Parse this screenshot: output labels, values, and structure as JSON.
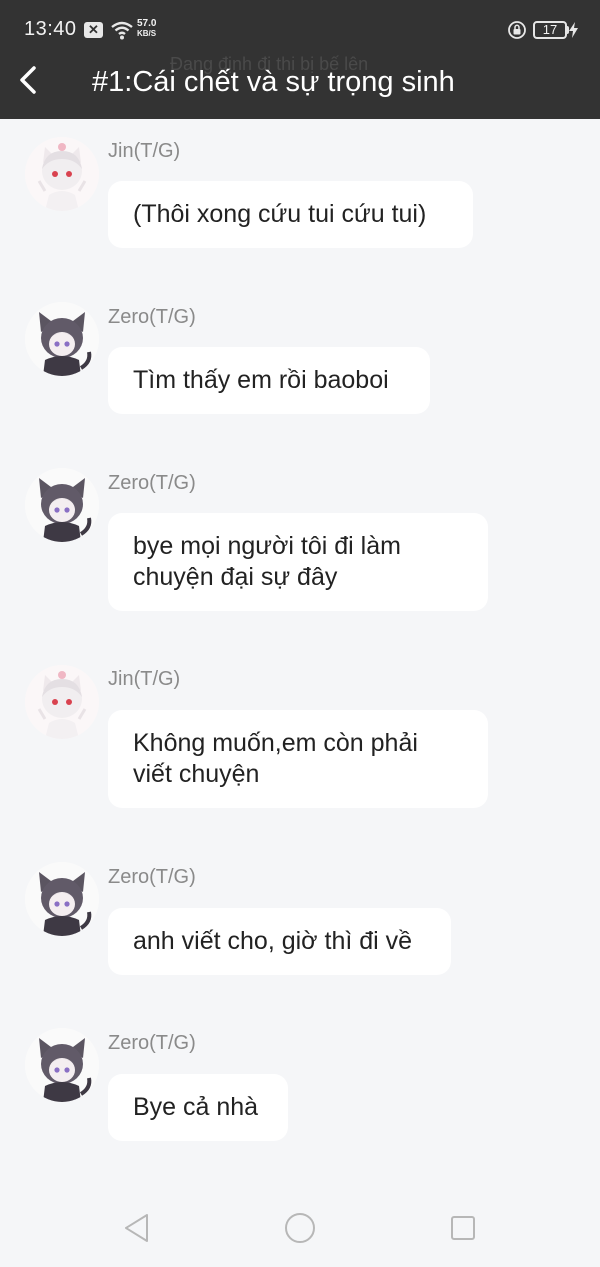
{
  "status_bar": {
    "time": "13:40",
    "speed_value": "57.0",
    "speed_unit": "KB/S",
    "battery": "17"
  },
  "header": {
    "title": "#1:Cái chết và sự trọng sinh",
    "ghost_text": "Đang định đi thi bị bế lên"
  },
  "messages": [
    {
      "sender": "Jin(T/G)",
      "avatar": "jin-avatar",
      "text": "(Thôi xong cứu tui cứu tui)"
    },
    {
      "sender": "Zero(T/G)",
      "avatar": "zero-avatar",
      "text": "Tìm thấy em rồi baoboi"
    },
    {
      "sender": "Zero(T/G)",
      "avatar": "zero-avatar",
      "text": "bye mọi người tôi đi làm chuyện đại sự đây"
    },
    {
      "sender": "Jin(T/G)",
      "avatar": "jin-avatar",
      "text": "Không muốn,em còn phải viết chuyện"
    },
    {
      "sender": "Zero(T/G)",
      "avatar": "zero-avatar",
      "text": "anh viết cho, giờ thì đi về"
    },
    {
      "sender": "Zero(T/G)",
      "avatar": "zero-avatar",
      "text": "Bye cả nhà"
    }
  ],
  "colors": {
    "header_bg": "#333333",
    "page_bg": "#f5f6f8",
    "bubble_bg": "#ffffff",
    "sender_name": "#8a8a8a"
  }
}
